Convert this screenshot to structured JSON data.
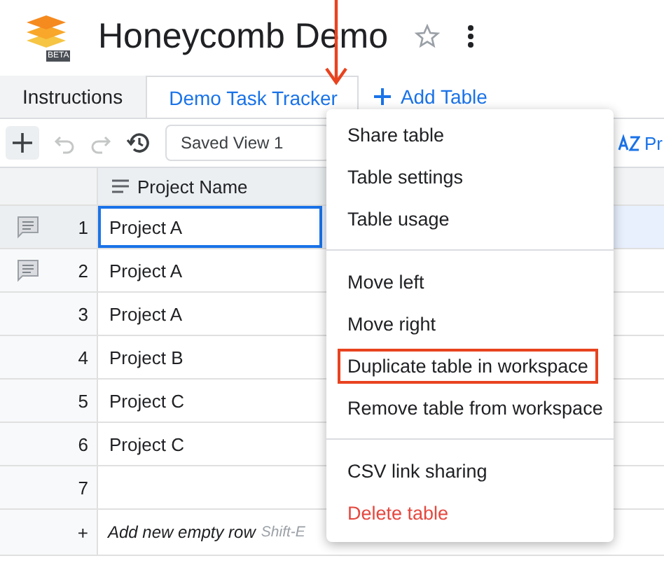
{
  "app": {
    "title": "Honeycomb Demo",
    "logo_badge": "BETA",
    "starred": false
  },
  "tabs": [
    {
      "label": "Instructions",
      "selected": false
    },
    {
      "label": "Demo Task Tracker",
      "selected": true
    }
  ],
  "add_table": "Add Table",
  "toolbar": {
    "view": "Saved View 1",
    "sort_label": "Pr"
  },
  "table": {
    "columns": [
      "Project Name"
    ],
    "rows": [
      {
        "number": "1",
        "project": "Project A",
        "has_comment": true,
        "selected": true
      },
      {
        "number": "2",
        "project": "Project A",
        "has_comment": true,
        "selected": false
      },
      {
        "number": "3",
        "project": "Project A",
        "has_comment": false,
        "selected": false
      },
      {
        "number": "4",
        "project": "Project B",
        "has_comment": false,
        "selected": false
      },
      {
        "number": "5",
        "project": "Project C",
        "has_comment": false,
        "selected": false
      },
      {
        "number": "6",
        "project": "Project C",
        "has_comment": false,
        "selected": false
      },
      {
        "number": "7",
        "project": "",
        "has_comment": false,
        "selected": false
      }
    ],
    "add_row": {
      "symbol": "+",
      "label": "Add new empty row",
      "hint": "Shift-E"
    }
  },
  "menu": {
    "items": [
      {
        "kind": "item",
        "label": "Share table",
        "highlighted": false,
        "danger": false
      },
      {
        "kind": "item",
        "label": "Table settings",
        "highlighted": false,
        "danger": false
      },
      {
        "kind": "item",
        "label": "Table usage",
        "highlighted": false,
        "danger": false
      },
      {
        "kind": "divider"
      },
      {
        "kind": "item",
        "label": "Move left",
        "highlighted": false,
        "danger": false
      },
      {
        "kind": "item",
        "label": "Move right",
        "highlighted": false,
        "danger": false
      },
      {
        "kind": "item",
        "label": "Duplicate table in workspace",
        "highlighted": true,
        "danger": false
      },
      {
        "kind": "item",
        "label": "Remove table from workspace",
        "highlighted": false,
        "danger": false
      },
      {
        "kind": "divider"
      },
      {
        "kind": "item",
        "label": "CSV link sharing",
        "highlighted": false,
        "danger": false
      },
      {
        "kind": "item",
        "label": "Delete table",
        "highlighted": false,
        "danger": true
      }
    ]
  },
  "annotation": {
    "arrow": true
  }
}
